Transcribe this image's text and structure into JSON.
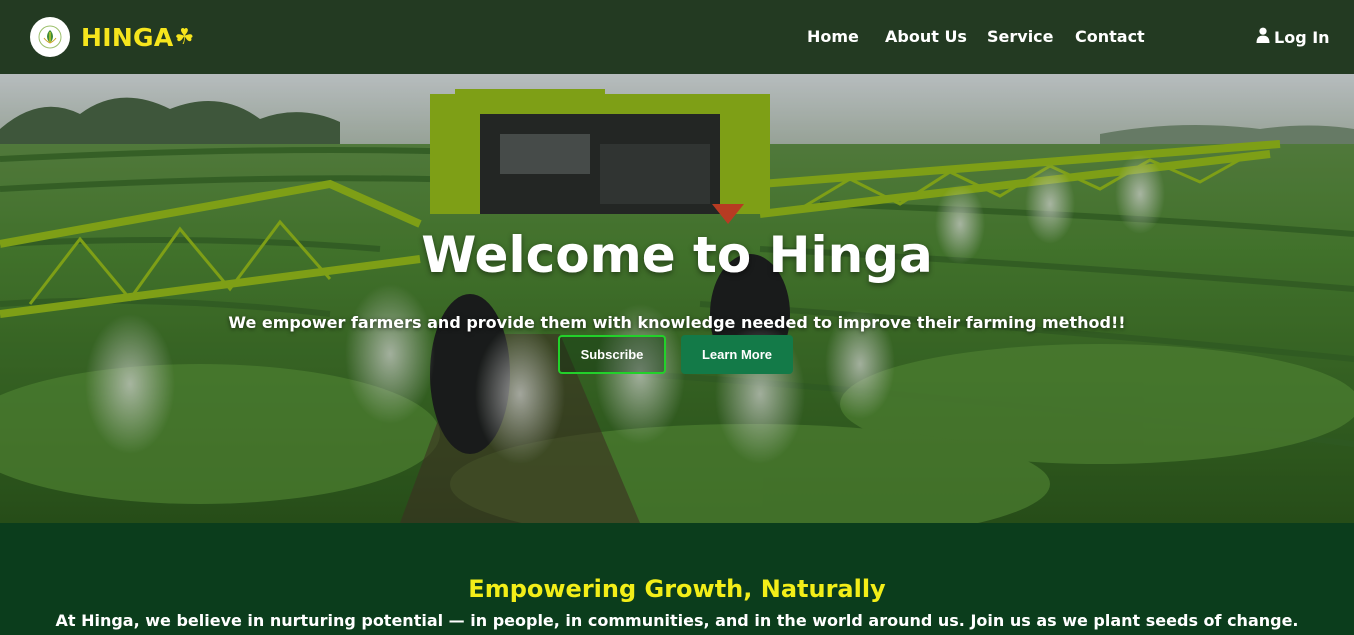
{
  "brand": {
    "name": "HINGA",
    "logo_icon": "leaf-emblem-icon",
    "accent_icon": "clover-icon",
    "accent_color": "#f6e51d"
  },
  "nav": {
    "items": [
      {
        "label": "Home"
      },
      {
        "label": "About Us"
      },
      {
        "label": "Service"
      },
      {
        "label": "Contact"
      }
    ],
    "login_label": "Log In",
    "login_icon": "user-icon"
  },
  "hero": {
    "title": "Welcome to Hinga",
    "subtitle": "We empower farmers and provide them with knowledge needed to improve their farming method!!",
    "subscribe_label": "Subscribe",
    "learn_more_label": "Learn More",
    "subscribe_border_color": "#22d12a",
    "learn_more_color": "#137a48"
  },
  "intro": {
    "title": "Empowering Growth, Naturally",
    "text": "At Hinga, we believe in nurturing potential — in people, in communities, and in the world around us. Join us as we plant seeds of change."
  },
  "colors": {
    "nav_bg": "#233a22",
    "section_bg": "#0b3d1c",
    "section_title": "#f3ee18"
  }
}
